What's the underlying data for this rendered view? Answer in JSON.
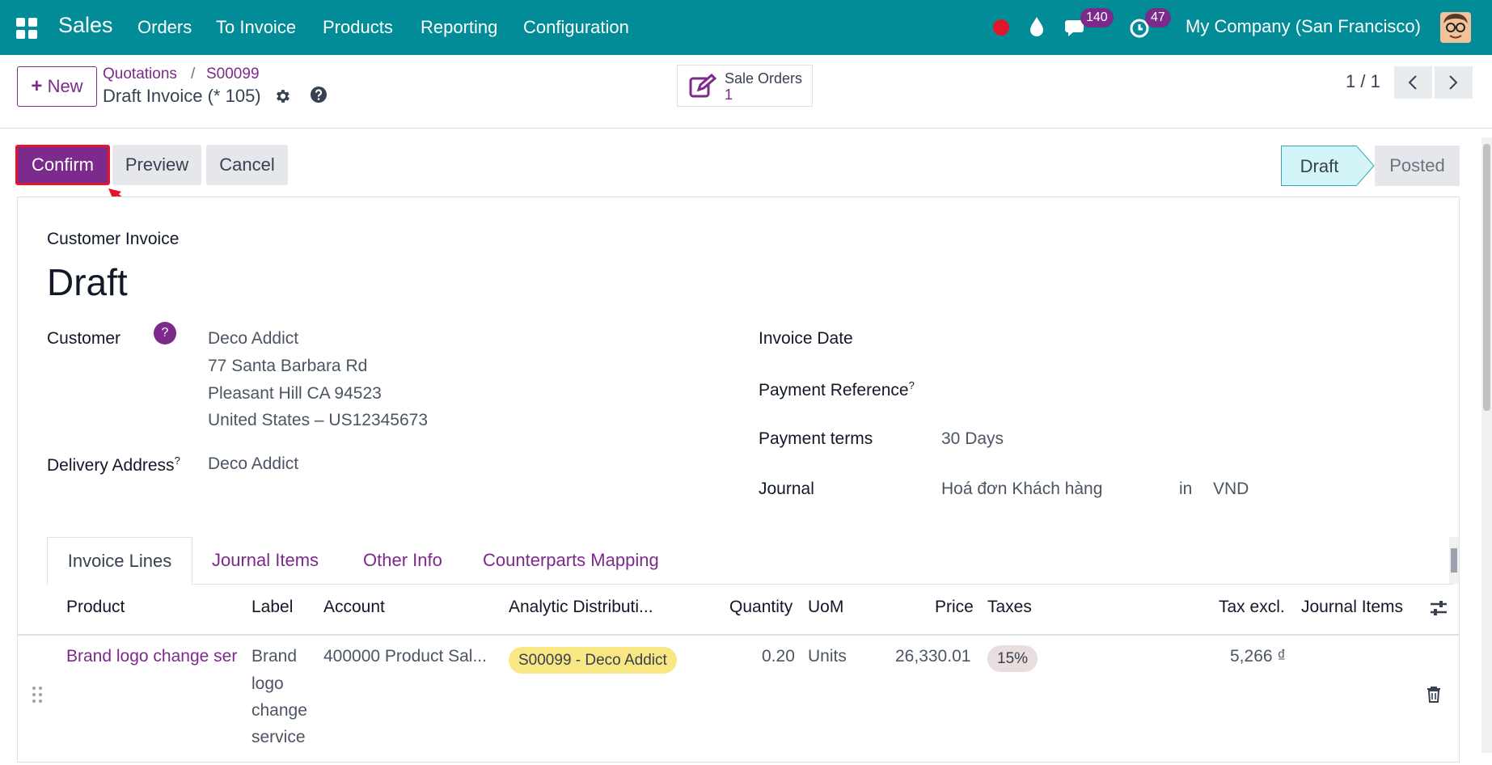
{
  "topbar": {
    "app_name": "Sales",
    "menu": [
      "Orders",
      "To Invoice",
      "Products",
      "Reporting",
      "Configuration"
    ],
    "messages_count": "140",
    "activities_count": "47",
    "company": "My Company (San Francisco)",
    "icons": [
      "apps-grid-icon",
      "record-icon",
      "droplet-icon",
      "chat-icon",
      "clock-icon",
      "avatar"
    ]
  },
  "control_panel": {
    "new_label": "New",
    "breadcrumb": [
      "Quotations",
      "S00099"
    ],
    "breadcrumb_sep": "/",
    "record_title": "Draft Invoice (* 105)",
    "smart_button": {
      "label": "Sale Orders",
      "value": "1"
    },
    "pager": "1 / 1"
  },
  "status_bar": {
    "buttons": [
      "Confirm",
      "Preview",
      "Cancel"
    ],
    "stages": [
      "Draft",
      "Posted"
    ],
    "active_stage": "Draft"
  },
  "form": {
    "doc_type": "Customer Invoice",
    "doc_name": "Draft",
    "customer_label": "Customer",
    "customer_help": "?",
    "customer_lines": [
      "Deco Addict",
      "77 Santa Barbara Rd",
      "Pleasant Hill CA 94523",
      "United States – US12345673"
    ],
    "delivery_label": "Delivery Address",
    "delivery_sup": "?",
    "delivery_value": "Deco Addict",
    "invoice_date_label": "Invoice Date",
    "payment_ref_label": "Payment Reference",
    "payment_ref_sup": "?",
    "payment_terms_label": "Payment terms",
    "payment_terms_value": "30 Days",
    "journal_label": "Journal",
    "journal_value": "Hoá đơn Khách hàng",
    "journal_in": "in",
    "journal_currency": "VND"
  },
  "tabs": [
    "Invoice Lines",
    "Journal Items",
    "Other Info",
    "Counterparts Mapping"
  ],
  "table": {
    "headers": [
      "Product",
      "Label",
      "Account",
      "Analytic Distributi...",
      "Quantity",
      "UoM",
      "Price",
      "Taxes",
      "Tax excl.",
      "Journal Items"
    ],
    "rows": [
      {
        "product": "Brand logo change ser",
        "label_lines": [
          "Brand",
          "logo",
          "change",
          "service"
        ],
        "account": "400000 Product Sal...",
        "analytic": "S00099 - Deco Addict",
        "quantity": "0.20",
        "uom": "Units",
        "price": "26,330.01",
        "taxes": "15%",
        "tax_excl": "5,266 ₫"
      }
    ]
  },
  "colors": {
    "topbar": "#018c97",
    "primary": "#7c2a8b",
    "highlight": "#e3152a",
    "analytic_tag": "#f9e784",
    "tax_tag": "#e8dede"
  }
}
